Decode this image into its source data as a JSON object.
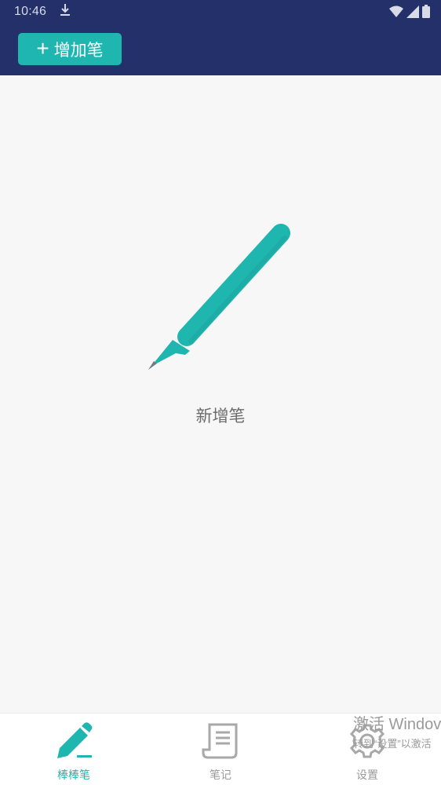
{
  "status_bar": {
    "time": "10:46"
  },
  "header": {
    "add_button_label": "增加笔",
    "add_button_plus": "+"
  },
  "empty_state": {
    "label": "新增笔"
  },
  "bottom_nav": {
    "items": [
      {
        "label": "棒棒笔",
        "icon": "pen-icon",
        "active": true
      },
      {
        "label": "笔记",
        "icon": "notes-icon",
        "active": false
      },
      {
        "label": "设置",
        "icon": "gear-icon",
        "active": false
      }
    ]
  },
  "watermark": {
    "line1": "激活 Windov",
    "line2": "转到“设置”以激活"
  },
  "colors": {
    "header_bg": "#23306a",
    "accent": "#20b6b0",
    "background": "#f7f7f7"
  }
}
